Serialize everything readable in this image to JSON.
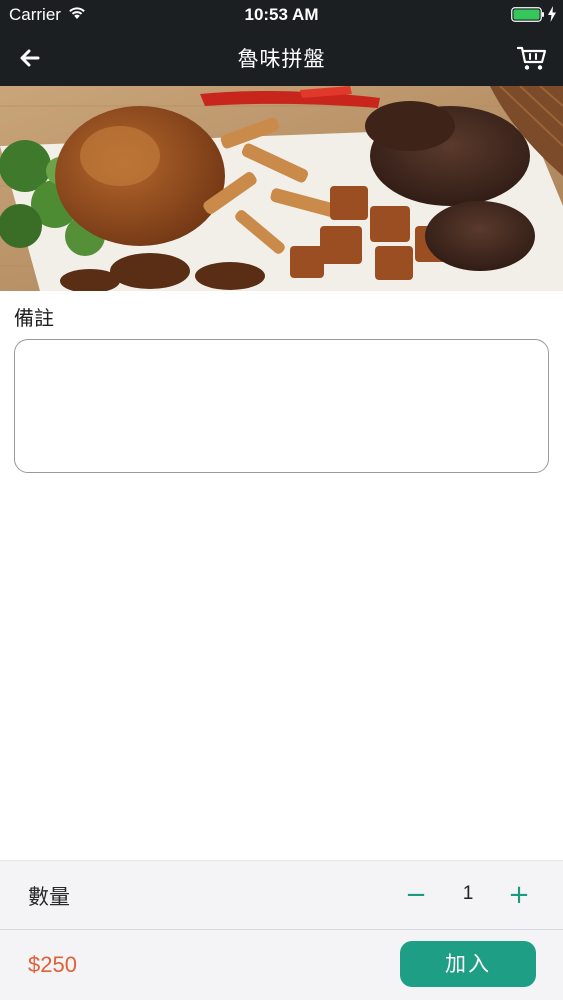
{
  "status_bar": {
    "carrier": "Carrier",
    "time": "10:53 AM"
  },
  "nav": {
    "title": "魯味拼盤",
    "back_icon": "arrow-left-icon",
    "cart_icon": "cart-icon"
  },
  "notes": {
    "label": "備註",
    "value": "",
    "placeholder": ""
  },
  "quantity": {
    "label": "數量",
    "minus": "−",
    "value": "1",
    "plus": "+"
  },
  "order": {
    "price": "$250",
    "add_label": "加入"
  },
  "colors": {
    "accent": "#1e9e84",
    "price": "#e0603a",
    "header": "#1b1f22"
  }
}
